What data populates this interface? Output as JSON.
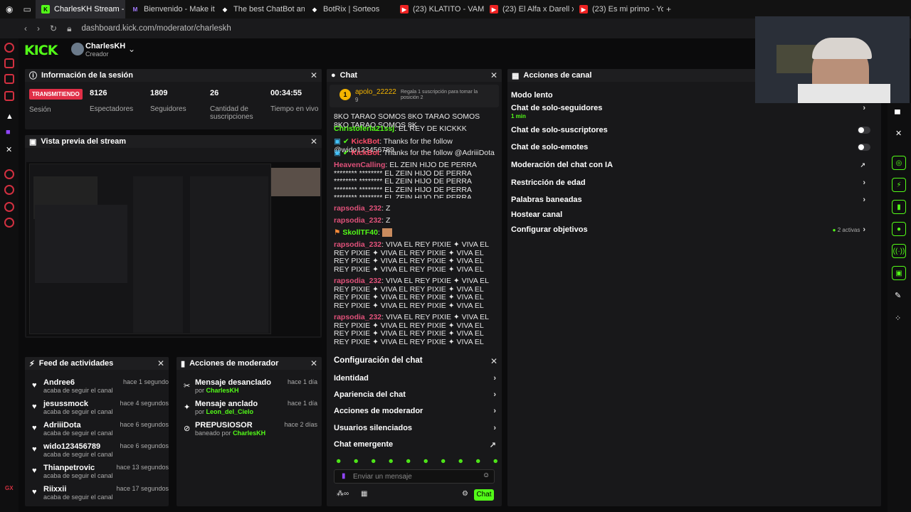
{
  "browser": {
    "tabs": [
      "CharlesKH Stream - Kick",
      "Bienvenido - Make it Mea",
      "The best ChatBot and W",
      "BotRix | Sorteos",
      "(23) KLATITO - VAMONO",
      "(23) El Alfa x Darell x Nor",
      "(23) Es mi primo - YouTub"
    ],
    "url": "dashboard.kick.com/moderator/charleskh"
  },
  "header": {
    "logo": "KICK",
    "channel_name": "CharlesKH",
    "role": "Creador"
  },
  "session": {
    "title": "Información de la sesión",
    "live_badge": "TRANSMITIENDO",
    "status_label": "Sesión",
    "stats": [
      {
        "value": "8126",
        "label": "Espectadores"
      },
      {
        "value": "1809",
        "label": "Seguidores"
      },
      {
        "value": "26",
        "label": "Cantidad de suscripciones"
      },
      {
        "value": "00:34:55",
        "label": "Tiempo en vivo"
      }
    ]
  },
  "preview": {
    "title": "Vista previa del stream"
  },
  "feed": {
    "title": "Feed de actividades",
    "items": [
      {
        "name": "Andree6",
        "action": "acaba de seguir el canal",
        "time": "hace 1 segundo"
      },
      {
        "name": "jesussmock",
        "action": "acaba de seguir el canal",
        "time": "hace 4 segundos"
      },
      {
        "name": "AdriiiDota",
        "action": "acaba de seguir el canal",
        "time": "hace 6 segundos"
      },
      {
        "name": "wido123456789",
        "action": "acaba de seguir el canal",
        "time": "hace 6 segundos"
      },
      {
        "name": "Thianpetrovic",
        "action": "acaba de seguir el canal",
        "time": "hace 13 segundos"
      },
      {
        "name": "Riixxii",
        "action": "acaba de seguir el canal",
        "time": "hace 17 segundos"
      }
    ]
  },
  "modactions": {
    "title": "Acciones de moderador",
    "items": [
      {
        "title": "Mensaje desanclado",
        "by_prefix": "por",
        "by": "CharlesKH",
        "time": "hace 1 día"
      },
      {
        "title": "Mensaje anclado",
        "by_prefix": "por",
        "by": "Leon_del_Cielo",
        "time": "hace 1 día"
      },
      {
        "title": "PREPUSIOSOR",
        "by_prefix": "baneado por",
        "by": "CharlesKH",
        "time": "hace 2 días"
      }
    ]
  },
  "chat": {
    "title": "Chat",
    "gift_user": "apolo_22222",
    "gift_count": "9",
    "gift_text": "Regala 1 suscripción para tomar la posición 2",
    "messages": [
      {
        "user": "",
        "text": "8KO TARAO SOMOS 8KO TARAO SOMOS 8KO TARAO SOMOS 8K",
        "cls": ""
      },
      {
        "user": "Christoferla21ssj",
        "text": ": EL REY DE KICKKK",
        "cls": "u1"
      },
      {
        "user": "KickBot",
        "text": ": Thanks for the follow @wido123456789",
        "cls": "u2"
      },
      {
        "user": "KickBot",
        "text": ": Thanks for the follow @AdriiiDota",
        "cls": "u2"
      },
      {
        "user": "HeavenCalling",
        "text": ": EL ZEIN HIJO DE PERRA ******** ******** EL ZEIN HIJO DE PERRA ******** ******** EL ZEIN HIJO DE PERRA ******** ******** EL ZEIN HIJO DE PERRA ******** ******** EL ZEIN HIJO DE PERRA ******** ******** EL ZEIN HIJO DE PERRA ******** ********",
        "cls": "u3"
      },
      {
        "user": "rapsodia_232",
        "text": ": Z",
        "cls": "u3"
      },
      {
        "user": "rapsodia_232",
        "text": ": Z",
        "cls": "u3"
      },
      {
        "user": "SkollTF40",
        "text": ":",
        "cls": "u1"
      },
      {
        "user": "rapsodia_232",
        "text": ": VIVA EL REY PIXIE ✦ VIVA EL REY PIXIE ✦ VIVA EL REY PIXIE ✦ VIVA EL REY PIXIE ✦ VIVA EL REY PIXIE ✦ VIVA EL REY PIXIE ✦ VIVA EL REY PIXIE ✦ VIVA EL REY PIXIE ✦ VIVA EL REY PIXIE ✦ VIVA EL REY PIXIE ✦ VIVA EL REY PIXIE ✦",
        "cls": "u3"
      },
      {
        "user": "rapsodia_232",
        "text": ": VIVA EL REY PIXIE ✦ VIVA EL REY PIXIE ✦ VIVA EL REY PIXIE ✦ VIVA EL REY PIXIE ✦ VIVA EL REY PIXIE ✦ VIVA EL REY PIXIE ✦ VIVA EL REY PIXIE ✦ VIVA EL REY PIXIE ✦ VIVA EL REY PIXIE ✦ VIVA EL REY PIXIE ✦ VIVA EL REY PIXIE ✦",
        "cls": "u3"
      },
      {
        "user": "rapsodia_232",
        "text": ": VIVA EL REY PIXIE ✦ VIVA EL REY PIXIE ✦ VIVA EL REY PIXIE ✦ VIVA EL REY PIXIE ✦ VIVA EL REY PIXIE ✦ VIVA EL REY PIXIE ✦ VIVA EL REY PIXIE ✦ VIVA EL REY PIXIE ✦ VIVA EL REY PIXIE ✦ VIVA EL REY PIXIE ✦ VIVA EL REY PIXIE ✦",
        "cls": "u3"
      }
    ],
    "config_title": "Configuración del chat",
    "config_items": [
      "Identidad",
      "Apariencia del chat",
      "Acciones de moderador",
      "Usuarios silenciados",
      "Chat emergente"
    ],
    "input_placeholder": "Enviar un mensaje",
    "send_label": "Chat"
  },
  "channel_actions": {
    "title": "Acciones de canal",
    "items": [
      {
        "label": "Modo lento",
        "control": "none"
      },
      {
        "label": "Chat de solo-seguidores",
        "sub": "1 min",
        "control": "chevron"
      },
      {
        "label": "Chat de solo-suscriptores",
        "control": "toggle"
      },
      {
        "label": "Chat de solo-emotes",
        "control": "toggle"
      },
      {
        "label": "Moderación del chat con IA",
        "control": "external"
      },
      {
        "label": "Restricción de edad",
        "control": "chevron"
      },
      {
        "label": "Palabras baneadas",
        "control": "chevron"
      },
      {
        "label": "Hostear canal",
        "control": "none"
      },
      {
        "label": "Configurar objetivos",
        "badge": "2 activas",
        "control": "chevron"
      }
    ]
  },
  "colors": {
    "accent": "#53fc18",
    "live": "#e02f47",
    "panel": "#18181a"
  }
}
